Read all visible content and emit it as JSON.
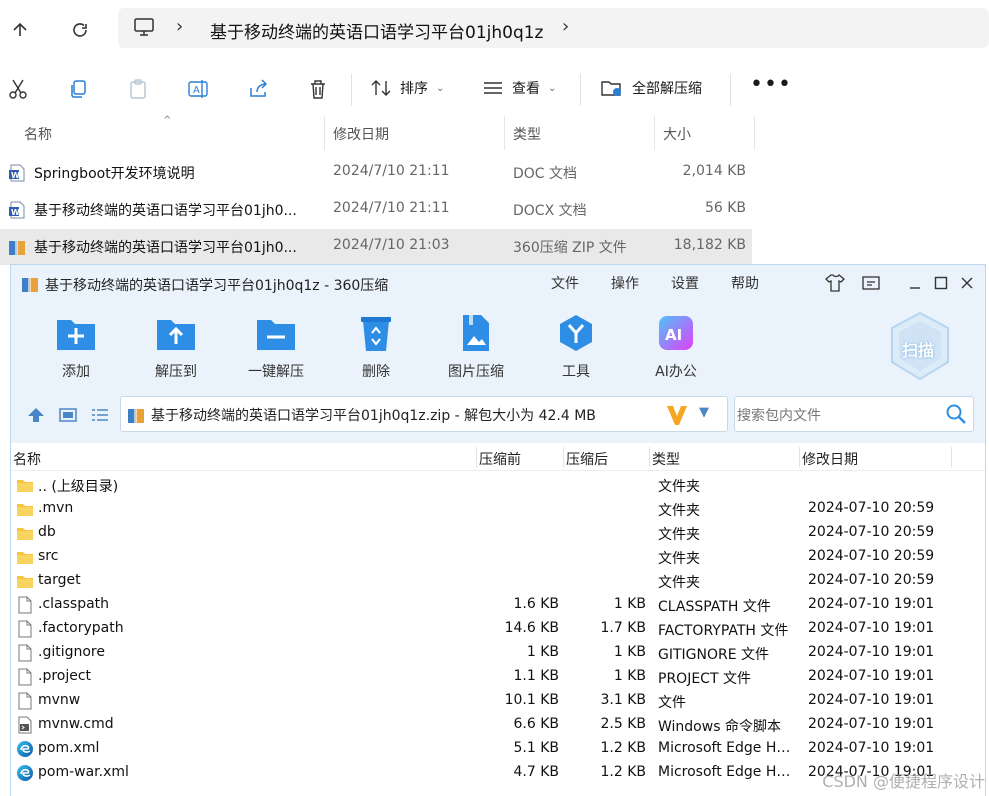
{
  "explorer": {
    "path": "基于移动终端的英语口语学习平台01jh0q1z",
    "toolbar": {
      "sort_label": "排序",
      "view_label": "查看",
      "extract_all_label": "全部解压缩"
    },
    "columns": {
      "name": "名称",
      "date": "修改日期",
      "type": "类型",
      "size": "大小"
    },
    "files": [
      {
        "name": "Springboot开发环境说明",
        "date": "2024/7/10 21:11",
        "type": "DOC 文档",
        "size": "2,014 KB",
        "icon": "word-doc-icon"
      },
      {
        "name": "基于移动终端的英语口语学习平台01jh0...",
        "date": "2024/7/10 21:11",
        "type": "DOCX 文档",
        "size": "56 KB",
        "icon": "word-doc-icon"
      },
      {
        "name": "基于移动终端的英语口语学习平台01jh0...",
        "date": "2024/7/10 21:03",
        "type": "360压缩 ZIP 文件",
        "size": "18,182 KB",
        "icon": "zip-archive-icon",
        "selected": true
      }
    ]
  },
  "zip": {
    "title": "基于移动终端的英语口语学习平台01jh0q1z - 360压缩",
    "menu": [
      "文件",
      "操作",
      "设置",
      "帮助"
    ],
    "tools": [
      {
        "label": "添加",
        "icon": "add-folder-icon"
      },
      {
        "label": "解压到",
        "icon": "extract-to-icon"
      },
      {
        "label": "一键解压",
        "icon": "one-click-extract-icon"
      },
      {
        "label": "删除",
        "icon": "recycle-bin-icon"
      },
      {
        "label": "图片压缩",
        "icon": "image-compress-icon"
      },
      {
        "label": "工具",
        "icon": "tools-icon"
      },
      {
        "label": "AI办公",
        "icon": "ai-office-icon"
      }
    ],
    "scan_label": "扫描",
    "path_text": "基于移动终端的英语口语学习平台01jh0q1z.zip - 解包大小为 42.4 MB",
    "search_placeholder": "搜索包内文件",
    "columns": {
      "name": "名称",
      "before": "压缩前",
      "after": "压缩后",
      "type": "类型",
      "date": "修改日期"
    },
    "rows": [
      {
        "name": ".. (上级目录)",
        "before": "",
        "after": "",
        "type": "文件夹",
        "date": "",
        "icon": "folder-icon"
      },
      {
        "name": ".mvn",
        "before": "",
        "after": "",
        "type": "文件夹",
        "date": "2024-07-10 20:59",
        "icon": "folder-icon"
      },
      {
        "name": "db",
        "before": "",
        "after": "",
        "type": "文件夹",
        "date": "2024-07-10 20:59",
        "icon": "folder-icon"
      },
      {
        "name": "src",
        "before": "",
        "after": "",
        "type": "文件夹",
        "date": "2024-07-10 20:59",
        "icon": "folder-icon"
      },
      {
        "name": "target",
        "before": "",
        "after": "",
        "type": "文件夹",
        "date": "2024-07-10 20:59",
        "icon": "folder-icon"
      },
      {
        "name": ".classpath",
        "before": "1.6 KB",
        "after": "1 KB",
        "type": "CLASSPATH 文件",
        "date": "2024-07-10 19:01",
        "icon": "file-icon"
      },
      {
        "name": ".factorypath",
        "before": "14.6 KB",
        "after": "1.7 KB",
        "type": "FACTORYPATH 文件",
        "date": "2024-07-10 19:01",
        "icon": "file-icon"
      },
      {
        "name": ".gitignore",
        "before": "1 KB",
        "after": "1 KB",
        "type": "GITIGNORE 文件",
        "date": "2024-07-10 19:01",
        "icon": "file-icon"
      },
      {
        "name": ".project",
        "before": "1.1 KB",
        "after": "1 KB",
        "type": "PROJECT 文件",
        "date": "2024-07-10 19:01",
        "icon": "file-icon"
      },
      {
        "name": "mvnw",
        "before": "10.1 KB",
        "after": "3.1 KB",
        "type": "文件",
        "date": "2024-07-10 19:01",
        "icon": "file-icon"
      },
      {
        "name": "mvnw.cmd",
        "before": "6.6 KB",
        "after": "2.5 KB",
        "type": "Windows 命令脚本",
        "date": "2024-07-10 19:01",
        "icon": "cmd-script-icon"
      },
      {
        "name": "pom.xml",
        "before": "5.1 KB",
        "after": "1.2 KB",
        "type": "Microsoft Edge HT...",
        "date": "2024-07-10 19:01",
        "icon": "edge-icon"
      },
      {
        "name": "pom-war.xml",
        "before": "4.7 KB",
        "after": "1.2 KB",
        "type": "Microsoft Edge HT...",
        "date": "2024-07-10 19:01",
        "icon": "edge-icon"
      }
    ]
  },
  "watermark": "CSDN @便捷程序设计",
  "colors": {
    "accent": "#1e88e5",
    "zip_bg": "#eaf3fb",
    "folder": "#f6c344",
    "selected_row": "#e9e9e9"
  }
}
